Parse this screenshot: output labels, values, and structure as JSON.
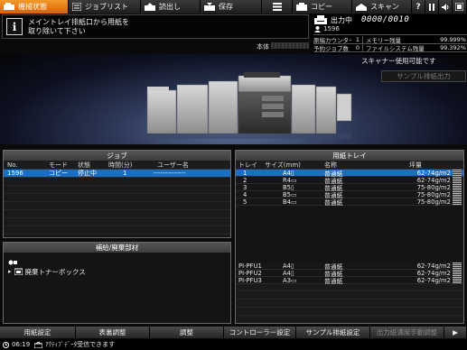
{
  "topbar": {
    "tabs": [
      {
        "label": "機械状態",
        "icon": "machine-icon",
        "active": true
      },
      {
        "label": "ジョブリスト",
        "icon": "list-icon",
        "active": false
      },
      {
        "label": "読出し",
        "icon": "retrieve-icon",
        "active": false
      },
      {
        "label": "保存",
        "icon": "save-icon",
        "active": false
      },
      {
        "label": "",
        "icon": "menu-icon",
        "active": false
      },
      {
        "label": "コピー",
        "icon": "copy-icon",
        "active": false
      },
      {
        "label": "スキャン",
        "icon": "scan-icon",
        "active": false
      }
    ],
    "utility_icons": [
      "help-icon",
      "pause-icon",
      "sound-icon",
      "settings-icon"
    ]
  },
  "message": {
    "line1": "メイントレイ排紙口から用紙を",
    "line2": "取り除いて下さい"
  },
  "machine_label": "本体",
  "status": {
    "state": "出力中",
    "counter": "0000/0010",
    "user": "1596",
    "rows": [
      {
        "label": "原稿カウンター",
        "value": "1",
        "label2": "メモリー残量",
        "value2": "99.999%"
      },
      {
        "label": "予約ジョブ数",
        "value": "0",
        "label2": "ファイルシステム残量",
        "value2": "99.392%"
      }
    ]
  },
  "scanner_status": "スキャナー使用可能です",
  "sample_output_button": "サンプル排紙出力",
  "jobs": {
    "title": "ジョブ",
    "headers": [
      "No.",
      "モード",
      "状態",
      "時間(分)",
      "ユーザー名"
    ],
    "rows": [
      {
        "no": "1596",
        "mode": "コピー",
        "state": "停止中",
        "time": "1",
        "user": "--------------"
      }
    ]
  },
  "supplies": {
    "title": "補給/廃棄部材",
    "items": [
      {
        "label": "",
        "icon": "toner-icon"
      },
      {
        "label": "廃棄トナーボックス",
        "icon": "waste-toner-icon"
      }
    ]
  },
  "trays": {
    "title": "用紙トレイ",
    "headers": [
      "トレイ",
      "サイズ(mm)",
      "名称",
      "坪量"
    ],
    "rows": [
      {
        "tray": "1",
        "size": "A4",
        "name": "普通紙",
        "weight": "62-74g/m2"
      },
      {
        "tray": "2",
        "size": "R4",
        "name": "普通紙",
        "weight": "62-74g/m2"
      },
      {
        "tray": "3",
        "size": "B5",
        "name": "普通紙",
        "weight": "75-80g/m2"
      },
      {
        "tray": "4",
        "size": "B5",
        "name": "普通紙",
        "weight": "75-80g/m2"
      },
      {
        "tray": "5",
        "size": "B4",
        "name": "普通紙",
        "weight": "75-80g/m2"
      }
    ],
    "pfu_rows": [
      {
        "tray": "PI-PFU1",
        "size": "A4",
        "name": "普通紙",
        "weight": "62-74g/m2"
      },
      {
        "tray": "PI-PFU2",
        "size": "A4",
        "name": "普通紙",
        "weight": "62-74g/m2"
      },
      {
        "tray": "PI-PFU3",
        "size": "A3",
        "name": "普通紙",
        "weight": "62-74g/m2"
      }
    ]
  },
  "bottom_buttons": [
    {
      "label": "用紙設定",
      "disabled": false
    },
    {
      "label": "表裏調整",
      "disabled": false
    },
    {
      "label": "調整",
      "disabled": false
    },
    {
      "label": "コントローラー設定",
      "disabled": false
    },
    {
      "label": "サンプル排紙設定",
      "disabled": false
    },
    {
      "label": "出力紙濃度手動調整",
      "disabled": true
    },
    {
      "label": "▶",
      "disabled": false
    }
  ],
  "statusline": {
    "time": "06:19",
    "message": "ｱｸﾃｨﾌﾞﾃﾞｰﾀ受信できます"
  },
  "colors": {
    "accent": "#e8781a",
    "selected": "#1a6fc2",
    "background": "#0a0a0a"
  }
}
